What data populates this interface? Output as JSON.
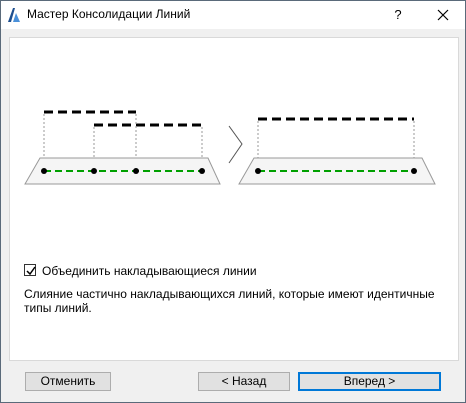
{
  "window": {
    "title": "Мастер Консолидации Линий",
    "help_label": "?"
  },
  "options": {
    "merge_overlapping": {
      "label": "Объединить накладывающиеся линии",
      "checked": true
    },
    "description": "Слияние частично накладывающихся линий, которые имеют идентичные типы линий."
  },
  "buttons": {
    "cancel": "Отменить",
    "back": "< Назад",
    "next": "Вперед >"
  },
  "colors": {
    "accent_line": "#00a000",
    "primary_border": "#0078d7"
  }
}
